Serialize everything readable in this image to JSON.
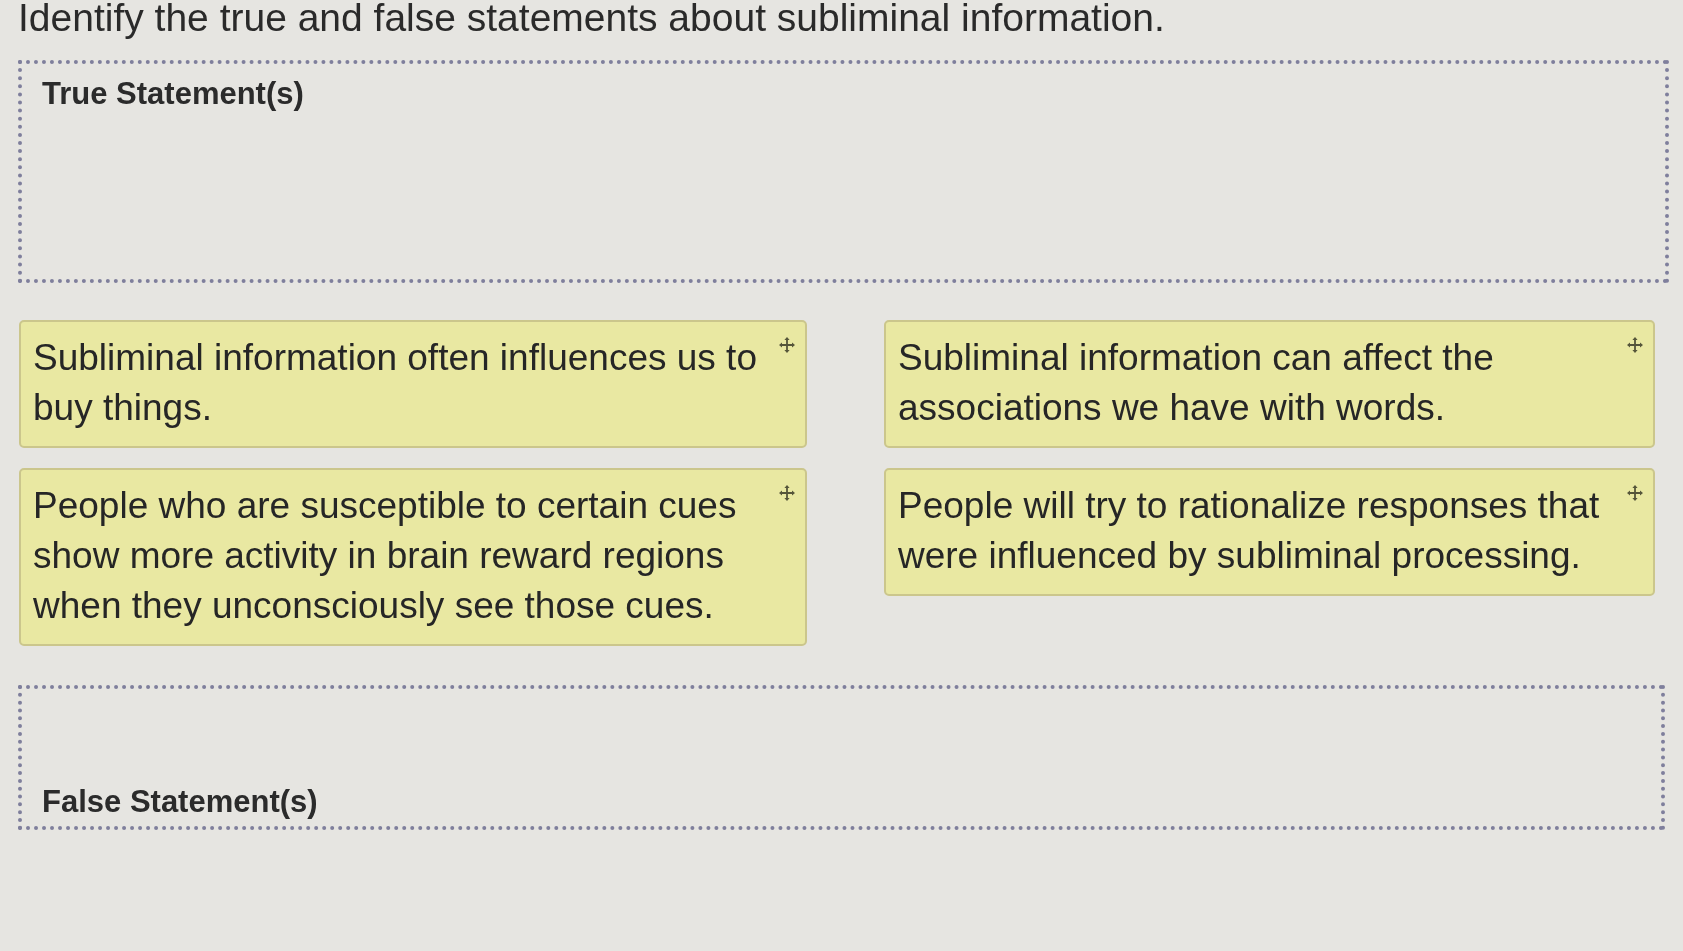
{
  "prompt": {
    "text": "Identify the true and false statements about subliminal information."
  },
  "true_zone": {
    "label": "True Statement(s)"
  },
  "statement_cards": [
    {
      "text": "Subliminal information often influences us to buy things."
    },
    {
      "text": "Subliminal information can affect the associations we have with words."
    },
    {
      "text": "People who are susceptible to certain cues show more activity in brain reward regions when they unconsciously see those cues."
    },
    {
      "text": "People will try to rationalize responses that were influenced by subliminal processing."
    }
  ],
  "false_zone": {
    "label": "False Statement(s)"
  }
}
